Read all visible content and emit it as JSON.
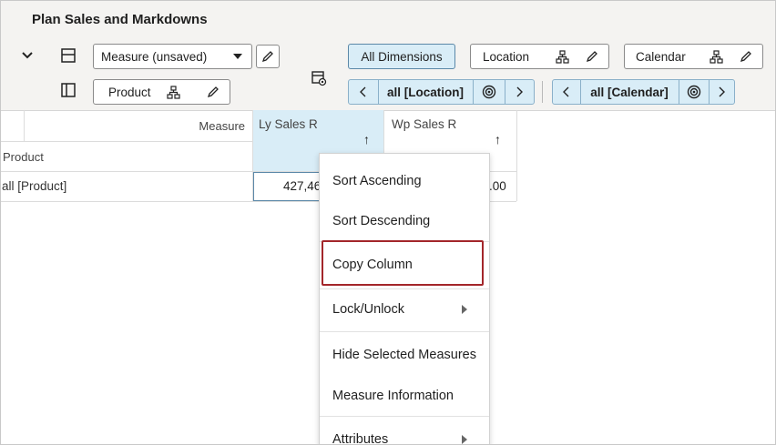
{
  "page": {
    "title": "Plan Sales and Markdowns"
  },
  "toolbar": {
    "measure_selector": "Measure (unsaved)",
    "product_tile": "Product",
    "all_dimensions": "All Dimensions",
    "location_tile": "Location",
    "calendar_tile": "Calendar",
    "location_nav": "all [Location]",
    "calendar_nav": "all [Calendar]"
  },
  "grid": {
    "measure_label": "Measure",
    "product_label": "Product",
    "columns": [
      {
        "label": "Ly Sales R",
        "sort": "↑"
      },
      {
        "label": "Wp Sales R",
        "sort": "↑"
      }
    ],
    "row_label": "all [Product]",
    "values": [
      "427,46",
      ".00"
    ]
  },
  "context_menu": {
    "items": [
      {
        "label": "Sort Ascending"
      },
      {
        "label": "Sort Descending"
      },
      {
        "label": "Copy Column"
      },
      {
        "label": "Lock/Unlock"
      },
      {
        "label": "Hide Selected Measures"
      },
      {
        "label": "Measure Information"
      },
      {
        "label": "Attributes"
      }
    ],
    "highlighted": "Copy Column"
  },
  "colors": {
    "accent_blue": "#d9edf7",
    "highlight_red": "#a3262a",
    "panel_bg": "#f4f3f1"
  }
}
